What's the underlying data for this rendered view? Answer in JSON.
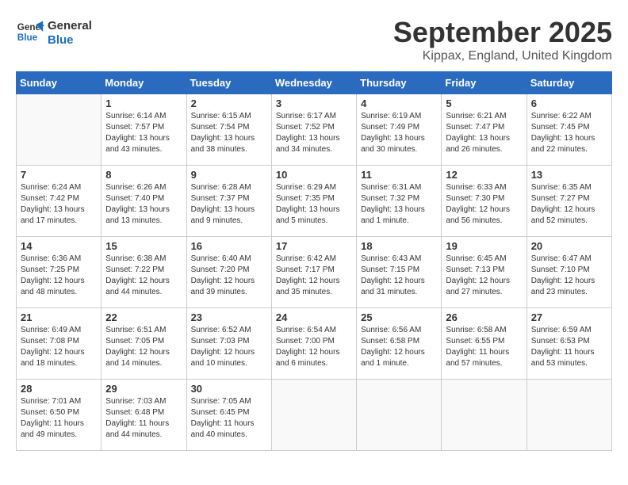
{
  "header": {
    "logo_line1": "General",
    "logo_line2": "Blue",
    "month_title": "September 2025",
    "location": "Kippax, England, United Kingdom"
  },
  "days_of_week": [
    "Sunday",
    "Monday",
    "Tuesday",
    "Wednesday",
    "Thursday",
    "Friday",
    "Saturday"
  ],
  "weeks": [
    [
      {
        "day": "",
        "sunrise": "",
        "sunset": "",
        "daylight": ""
      },
      {
        "day": "1",
        "sunrise": "Sunrise: 6:14 AM",
        "sunset": "Sunset: 7:57 PM",
        "daylight": "Daylight: 13 hours and 43 minutes."
      },
      {
        "day": "2",
        "sunrise": "Sunrise: 6:15 AM",
        "sunset": "Sunset: 7:54 PM",
        "daylight": "Daylight: 13 hours and 38 minutes."
      },
      {
        "day": "3",
        "sunrise": "Sunrise: 6:17 AM",
        "sunset": "Sunset: 7:52 PM",
        "daylight": "Daylight: 13 hours and 34 minutes."
      },
      {
        "day": "4",
        "sunrise": "Sunrise: 6:19 AM",
        "sunset": "Sunset: 7:49 PM",
        "daylight": "Daylight: 13 hours and 30 minutes."
      },
      {
        "day": "5",
        "sunrise": "Sunrise: 6:21 AM",
        "sunset": "Sunset: 7:47 PM",
        "daylight": "Daylight: 13 hours and 26 minutes."
      },
      {
        "day": "6",
        "sunrise": "Sunrise: 6:22 AM",
        "sunset": "Sunset: 7:45 PM",
        "daylight": "Daylight: 13 hours and 22 minutes."
      }
    ],
    [
      {
        "day": "7",
        "sunrise": "Sunrise: 6:24 AM",
        "sunset": "Sunset: 7:42 PM",
        "daylight": "Daylight: 13 hours and 17 minutes."
      },
      {
        "day": "8",
        "sunrise": "Sunrise: 6:26 AM",
        "sunset": "Sunset: 7:40 PM",
        "daylight": "Daylight: 13 hours and 13 minutes."
      },
      {
        "day": "9",
        "sunrise": "Sunrise: 6:28 AM",
        "sunset": "Sunset: 7:37 PM",
        "daylight": "Daylight: 13 hours and 9 minutes."
      },
      {
        "day": "10",
        "sunrise": "Sunrise: 6:29 AM",
        "sunset": "Sunset: 7:35 PM",
        "daylight": "Daylight: 13 hours and 5 minutes."
      },
      {
        "day": "11",
        "sunrise": "Sunrise: 6:31 AM",
        "sunset": "Sunset: 7:32 PM",
        "daylight": "Daylight: 13 hours and 1 minute."
      },
      {
        "day": "12",
        "sunrise": "Sunrise: 6:33 AM",
        "sunset": "Sunset: 7:30 PM",
        "daylight": "Daylight: 12 hours and 56 minutes."
      },
      {
        "day": "13",
        "sunrise": "Sunrise: 6:35 AM",
        "sunset": "Sunset: 7:27 PM",
        "daylight": "Daylight: 12 hours and 52 minutes."
      }
    ],
    [
      {
        "day": "14",
        "sunrise": "Sunrise: 6:36 AM",
        "sunset": "Sunset: 7:25 PM",
        "daylight": "Daylight: 12 hours and 48 minutes."
      },
      {
        "day": "15",
        "sunrise": "Sunrise: 6:38 AM",
        "sunset": "Sunset: 7:22 PM",
        "daylight": "Daylight: 12 hours and 44 minutes."
      },
      {
        "day": "16",
        "sunrise": "Sunrise: 6:40 AM",
        "sunset": "Sunset: 7:20 PM",
        "daylight": "Daylight: 12 hours and 39 minutes."
      },
      {
        "day": "17",
        "sunrise": "Sunrise: 6:42 AM",
        "sunset": "Sunset: 7:17 PM",
        "daylight": "Daylight: 12 hours and 35 minutes."
      },
      {
        "day": "18",
        "sunrise": "Sunrise: 6:43 AM",
        "sunset": "Sunset: 7:15 PM",
        "daylight": "Daylight: 12 hours and 31 minutes."
      },
      {
        "day": "19",
        "sunrise": "Sunrise: 6:45 AM",
        "sunset": "Sunset: 7:13 PM",
        "daylight": "Daylight: 12 hours and 27 minutes."
      },
      {
        "day": "20",
        "sunrise": "Sunrise: 6:47 AM",
        "sunset": "Sunset: 7:10 PM",
        "daylight": "Daylight: 12 hours and 23 minutes."
      }
    ],
    [
      {
        "day": "21",
        "sunrise": "Sunrise: 6:49 AM",
        "sunset": "Sunset: 7:08 PM",
        "daylight": "Daylight: 12 hours and 18 minutes."
      },
      {
        "day": "22",
        "sunrise": "Sunrise: 6:51 AM",
        "sunset": "Sunset: 7:05 PM",
        "daylight": "Daylight: 12 hours and 14 minutes."
      },
      {
        "day": "23",
        "sunrise": "Sunrise: 6:52 AM",
        "sunset": "Sunset: 7:03 PM",
        "daylight": "Daylight: 12 hours and 10 minutes."
      },
      {
        "day": "24",
        "sunrise": "Sunrise: 6:54 AM",
        "sunset": "Sunset: 7:00 PM",
        "daylight": "Daylight: 12 hours and 6 minutes."
      },
      {
        "day": "25",
        "sunrise": "Sunrise: 6:56 AM",
        "sunset": "Sunset: 6:58 PM",
        "daylight": "Daylight: 12 hours and 1 minute."
      },
      {
        "day": "26",
        "sunrise": "Sunrise: 6:58 AM",
        "sunset": "Sunset: 6:55 PM",
        "daylight": "Daylight: 11 hours and 57 minutes."
      },
      {
        "day": "27",
        "sunrise": "Sunrise: 6:59 AM",
        "sunset": "Sunset: 6:53 PM",
        "daylight": "Daylight: 11 hours and 53 minutes."
      }
    ],
    [
      {
        "day": "28",
        "sunrise": "Sunrise: 7:01 AM",
        "sunset": "Sunset: 6:50 PM",
        "daylight": "Daylight: 11 hours and 49 minutes."
      },
      {
        "day": "29",
        "sunrise": "Sunrise: 7:03 AM",
        "sunset": "Sunset: 6:48 PM",
        "daylight": "Daylight: 11 hours and 44 minutes."
      },
      {
        "day": "30",
        "sunrise": "Sunrise: 7:05 AM",
        "sunset": "Sunset: 6:45 PM",
        "daylight": "Daylight: 11 hours and 40 minutes."
      },
      {
        "day": "",
        "sunrise": "",
        "sunset": "",
        "daylight": ""
      },
      {
        "day": "",
        "sunrise": "",
        "sunset": "",
        "daylight": ""
      },
      {
        "day": "",
        "sunrise": "",
        "sunset": "",
        "daylight": ""
      },
      {
        "day": "",
        "sunrise": "",
        "sunset": "",
        "daylight": ""
      }
    ]
  ]
}
